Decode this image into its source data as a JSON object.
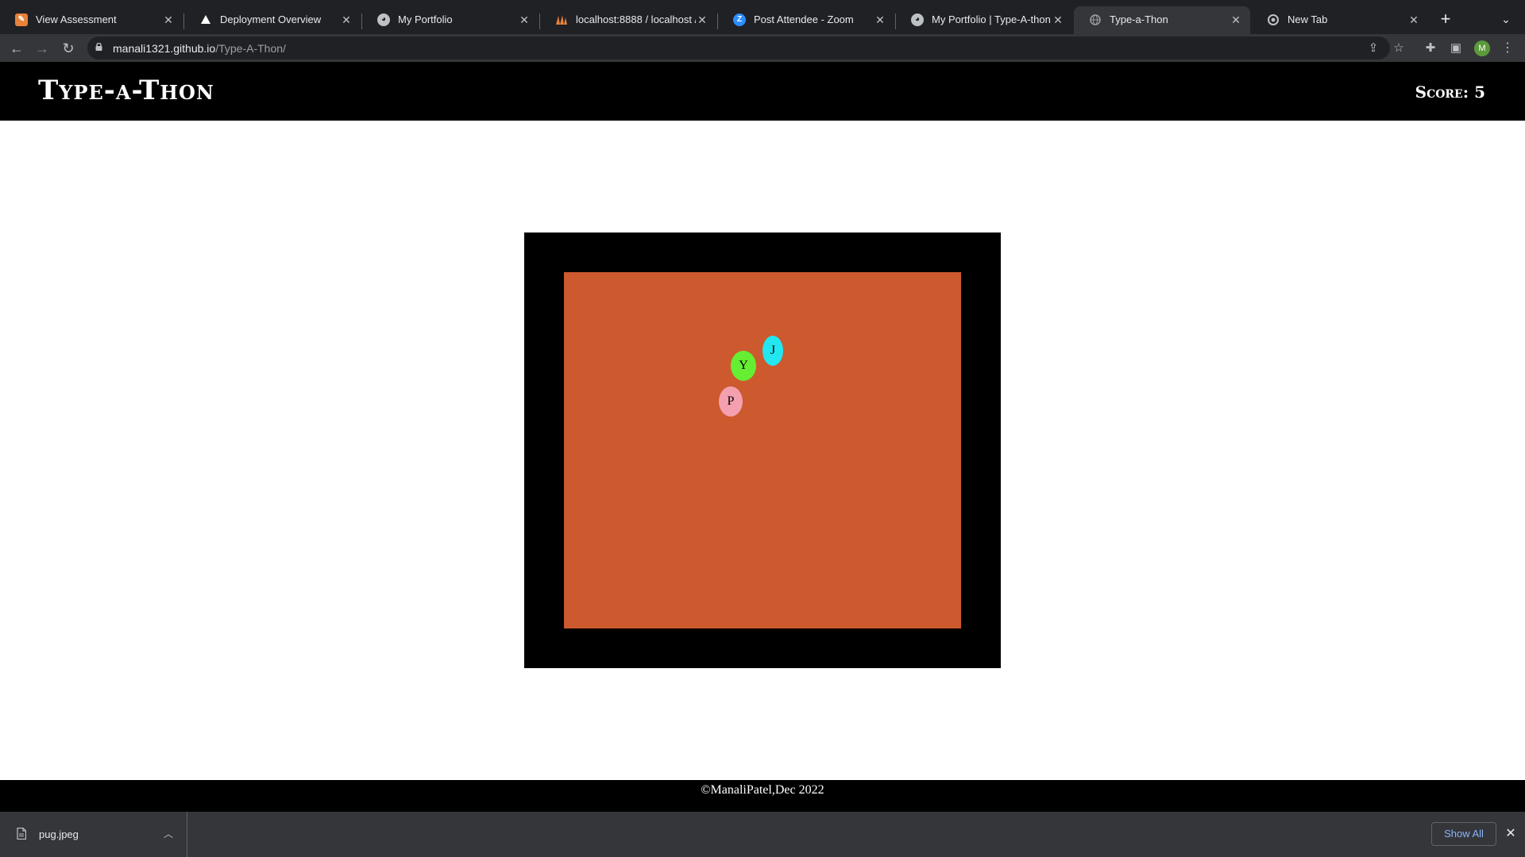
{
  "browser": {
    "tabs": [
      {
        "title": "View Assessment",
        "icon": "pencil-ruler-icon",
        "color": "#e8823a"
      },
      {
        "title": "Deployment Overview",
        "icon": "vercel-triangle-icon",
        "color": "#ffffff"
      },
      {
        "title": "My Portfolio",
        "icon": "github-icon",
        "color": "#bdc1c6"
      },
      {
        "title": "localhost:8888 / localhost / ...",
        "icon": "phpmyadmin-icon",
        "color": "#e8823a"
      },
      {
        "title": "Post Attendee - Zoom",
        "icon": "zoom-icon",
        "color": "#2d8cff"
      },
      {
        "title": "My Portfolio | Type-A-thon",
        "icon": "github-icon",
        "color": "#bdc1c6"
      },
      {
        "title": "Type-a-Thon",
        "icon": "globe-icon",
        "color": "#9aa0a6",
        "active": true
      },
      {
        "title": "New Tab",
        "icon": "chrome-icon",
        "color": "#bdc1c6"
      }
    ],
    "url_host": "manali1321.github.io",
    "url_path": "/Type-A-Thon/",
    "profile_initial": "M"
  },
  "page": {
    "site_title": "Type-a-Thon",
    "score_label": "Score: 5",
    "footer": "©ManaliPatel,Dec 2022",
    "colors": {
      "header_bg": "#000000",
      "game_frame": "#000000",
      "game_area": "#cc5a2e"
    }
  },
  "game": {
    "bubbles": [
      {
        "letter": "J",
        "color": "#22e6f0"
      },
      {
        "letter": "Y",
        "color": "#66ee33"
      },
      {
        "letter": "P",
        "color": "#f4a0b0"
      }
    ]
  },
  "downloads": {
    "file_name": "pug.jpeg",
    "show_all_label": "Show All"
  }
}
